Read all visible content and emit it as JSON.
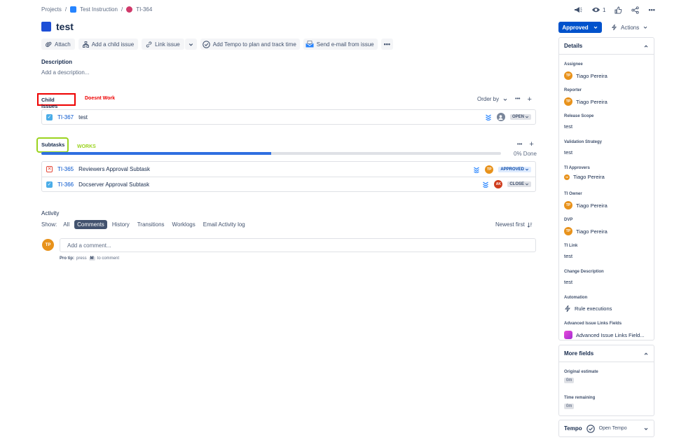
{
  "breadcrumb": {
    "projects": "Projects",
    "sep": "/",
    "project": "Test Instruction",
    "issue": "TI-364"
  },
  "issue": {
    "title": "test"
  },
  "toolbar": {
    "attach": "Attach",
    "add_child": "Add a child issue",
    "link_issue": "Link issue",
    "tempo": "Add Tempo to plan and track time",
    "email": "Send e-mail from issue"
  },
  "description": {
    "label": "Description",
    "placeholder": "Add a description..."
  },
  "child_issues": {
    "label": "Child issues",
    "annotation": "Doesnt Work",
    "order_by": "Order by",
    "items": [
      {
        "key": "TI-367",
        "summary": "test",
        "status": "OPEN"
      }
    ]
  },
  "subtasks": {
    "label": "Subtasks",
    "annotation": "WORKS",
    "progress_text": "0% Done",
    "progress_fraction": 0.5,
    "items": [
      {
        "key": "TI-365",
        "summary": "Reviewers Approval Subtask",
        "status": "APPROVED",
        "avatar": "TP"
      },
      {
        "key": "TI-366",
        "summary": "Docserver Approval Subtask",
        "status": "CLOSE",
        "avatar": "AK"
      }
    ]
  },
  "activity": {
    "label": "Activity",
    "show": "Show:",
    "tabs": [
      "All",
      "Comments",
      "History",
      "Transitions",
      "Worklogs",
      "Email Activity log"
    ],
    "newest": "Newest first",
    "comment_placeholder": "Add a comment...",
    "avatar": "TP",
    "pro_tip": "Pro tip:",
    "press": "press",
    "key": "M",
    "to_comment": "to comment"
  },
  "header": {
    "watch_count": "1"
  },
  "status_button": "Approved",
  "actions": "Actions",
  "details": {
    "title": "Details",
    "fields": [
      {
        "label": "Assignee",
        "value": "Tiago Pereira",
        "avatar": "TP"
      },
      {
        "label": "Reporter",
        "value": "Tiago Pereira",
        "avatar": "TP"
      },
      {
        "label": "Release Scope",
        "value": "test"
      },
      {
        "label": "Validation Strategy",
        "value": "test"
      },
      {
        "label": "TI Approvers",
        "value": "Tiago Pereira",
        "avatar": "TP"
      },
      {
        "label": "TI Owner",
        "value": "Tiago Pereira",
        "avatar": "TP"
      },
      {
        "label": "DVP",
        "value": "Tiago Pereira",
        "avatar": "TP"
      },
      {
        "label": "TI Link",
        "value": "test"
      },
      {
        "label": "Change Description",
        "value": "test"
      },
      {
        "label": "Automation",
        "value": "Rule executions"
      },
      {
        "label": "Advanced Issue Links Fields",
        "value": "Advanced Issue Links Field..."
      }
    ]
  },
  "more_fields": {
    "title": "More fields",
    "fields": [
      {
        "label": "Original estimate",
        "value": "0m"
      },
      {
        "label": "Time remaining",
        "value": "0m"
      }
    ]
  },
  "tempo": {
    "title": "Tempo",
    "open": "Open Tempo"
  },
  "colors": {
    "primary": "#0052cc",
    "annotation_red": "#ee0000",
    "annotation_green": "#9bd31f",
    "progress": "#2f6fe0"
  }
}
